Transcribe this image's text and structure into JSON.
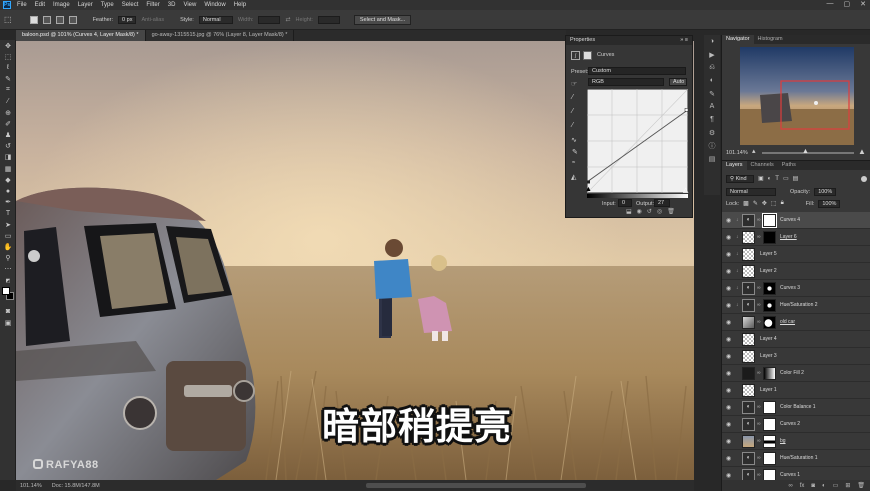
{
  "menu": {
    "logo": "Ps",
    "items": [
      "File",
      "Edit",
      "Image",
      "Layer",
      "Type",
      "Select",
      "Filter",
      "3D",
      "View",
      "Window",
      "Help"
    ],
    "window_buttons": [
      "—",
      "▢",
      "✕"
    ]
  },
  "options_bar": {
    "feather_label": "Feather:",
    "feather_value": "0 px",
    "anti_alias_label": "Anti-alias",
    "style_label": "Style:",
    "style_value": "Normal",
    "width_label": "Width:",
    "height_label": "Height:",
    "select_mask_button": "Select and Mask..."
  },
  "tabs": [
    {
      "label": "baloon.psd @ 101% (Curves 4, Layer Mask/8) *",
      "active": true
    },
    {
      "label": "go-away-1315515.jpg @ 76% (Layer 8, Layer Mask/8) *",
      "active": false
    }
  ],
  "status": {
    "zoom": "101.14%",
    "doc": "Doc: 15.8M/147.8M"
  },
  "subtitle": "暗部稍提亮",
  "watermark": "RAFYA88",
  "properties": {
    "title": "Properties",
    "adjustment_name": "Curves",
    "preset_label": "Preset:",
    "preset_value": "Custom",
    "channel_value": "RGB",
    "auto_button": "Auto",
    "input_label": "Input:",
    "input_value": "0",
    "output_label": "Output:",
    "output_value": "27",
    "curve_points": [
      [
        0,
        27
      ],
      [
        255,
        204
      ]
    ]
  },
  "navigator": {
    "tabs": [
      "Navigator",
      "Histogram"
    ],
    "zoom": "101.14%"
  },
  "layers_panel": {
    "tabs": [
      "Layers",
      "Channels",
      "Paths"
    ],
    "kind_label": "Kind",
    "blend_mode": "Normal",
    "opacity_label": "Opacity:",
    "opacity_value": "100%",
    "lock_label": "Lock:",
    "fill_label": "Fill:",
    "fill_value": "100%",
    "layers": [
      {
        "name": "Curves 4",
        "type": "adjustment",
        "selected": true,
        "mask": "white",
        "clipped": true
      },
      {
        "name": "Layer 6",
        "type": "pixel",
        "selected": false,
        "mask": "black",
        "clipped": true
      },
      {
        "name": "Layer 5",
        "type": "pixel",
        "selected": false,
        "mask": "none",
        "clipped": true
      },
      {
        "name": "Layer 2",
        "type": "pixel",
        "selected": false,
        "mask": "none",
        "clipped": true
      },
      {
        "name": "Curves 3",
        "type": "adjustment",
        "selected": false,
        "mask": "spot",
        "clipped": true
      },
      {
        "name": "Hue/Saturation 2",
        "type": "adjustment",
        "selected": false,
        "mask": "spot",
        "clipped": true
      },
      {
        "name": "old car",
        "type": "pixel",
        "selected": false,
        "mask": "car",
        "clipped": false
      },
      {
        "name": "Layer 4",
        "type": "pixel",
        "selected": false,
        "mask": "none",
        "clipped": false
      },
      {
        "name": "Layer 3",
        "type": "pixel",
        "selected": false,
        "mask": "none",
        "clipped": false
      },
      {
        "name": "Color Fill 2",
        "type": "fill",
        "selected": false,
        "mask": "gradient",
        "clipped": false
      },
      {
        "name": "Layer 1",
        "type": "pixel",
        "selected": false,
        "mask": "none",
        "clipped": false
      },
      {
        "name": "Color Balance 1",
        "type": "adjustment",
        "selected": false,
        "mask": "white",
        "clipped": false
      },
      {
        "name": "Curves 2",
        "type": "adjustment",
        "selected": false,
        "mask": "white",
        "clipped": false
      },
      {
        "name": "bg",
        "type": "pixel",
        "selected": false,
        "mask": "band",
        "clipped": false
      },
      {
        "name": "Hue/Saturation 1",
        "type": "adjustment",
        "selected": false,
        "mask": "white",
        "clipped": false
      },
      {
        "name": "Curves 1",
        "type": "adjustment",
        "selected": false,
        "mask": "white",
        "clipped": false
      }
    ]
  },
  "colors": {
    "accent": "#31a8ff",
    "panel": "#383838",
    "selected_row": "#4a4a4a",
    "navigator_frame": "#e03c3c"
  }
}
